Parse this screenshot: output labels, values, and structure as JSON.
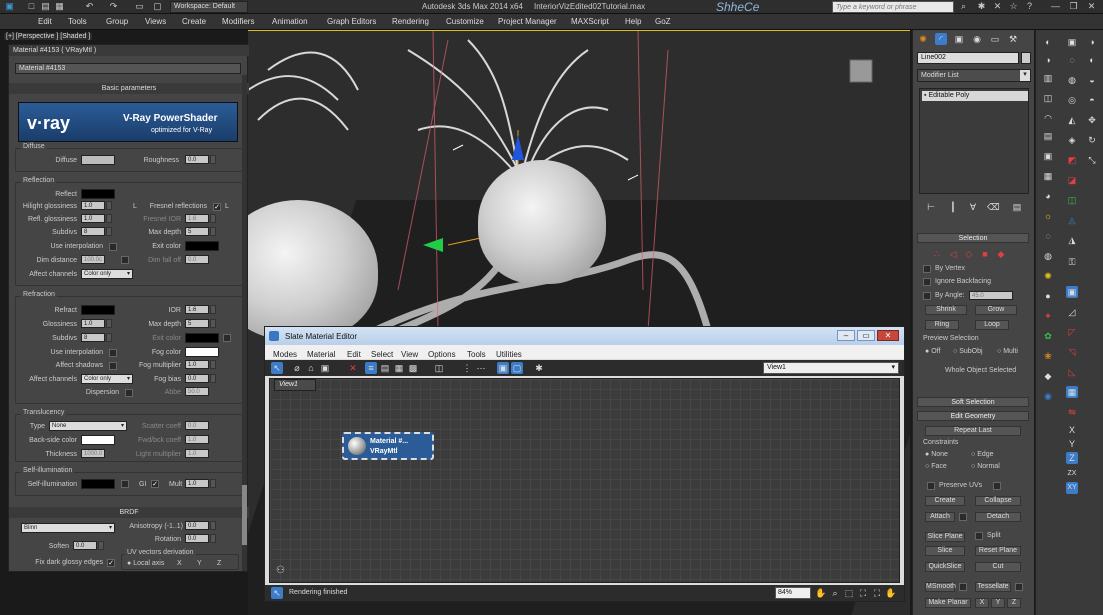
{
  "title_bar": {
    "workspace": "Workspace: Default",
    "app_title": "Autodesk 3ds Max  2014 x64",
    "file_name": "InteriorVizEdited02Tutorial.max",
    "logo_text": "ShheCe",
    "search_placeholder": "Type a keyword or phrase"
  },
  "menu": [
    "Edit",
    "Tools",
    "Group",
    "Views",
    "Create",
    "Modifiers",
    "Animation",
    "Graph Editors",
    "Rendering",
    "Customize",
    "Project Manager",
    "MAXScript",
    "Help",
    "GoZ"
  ],
  "viewport": {
    "label": "[+] [Perspective ] [Shaded ]"
  },
  "material_panel": {
    "title": "Material #4153  ( VRayMtl )",
    "name_field": "Material #4153",
    "basic_params": "Basic parameters",
    "banner": {
      "logo": "v·ray",
      "title": "V-Ray PowerShader",
      "subtitle": "optimized for V-Ray"
    },
    "diffuse": {
      "group": "Diffuse",
      "diffuse": "Diffuse",
      "roughness": "Roughness",
      "roughness_val": "0.0"
    },
    "reflection": {
      "group": "Reflection",
      "reflect": "Reflect",
      "hilight": "Hilight glossiness",
      "hilight_val": "1.0",
      "L": "L",
      "fresnel": "Fresnel reflections",
      "L2": "L",
      "refl_gloss": "Refl. glossiness",
      "refl_gloss_val": "1.0",
      "fresnel_ior": "Fresnel IOR",
      "fresnel_ior_val": "1.6",
      "subdivs": "Subdivs",
      "subdivs_val": "8",
      "max_depth": "Max depth",
      "max_depth_val": "5",
      "use_interp": "Use interpolation",
      "exit_color": "Exit color",
      "dim_distance": "Dim distance",
      "dim_distance_val": "100.0c",
      "dim_fall_off": "Dim fall off",
      "dim_fall_off_val": "0.0",
      "affect_channels": "Affect channels",
      "affect_val": "Color only"
    },
    "refraction": {
      "group": "Refraction",
      "refract": "Refract",
      "ior": "IOR",
      "ior_val": "1.6",
      "glossiness": "Glossiness",
      "glossiness_val": "1.0",
      "max_depth": "Max depth",
      "max_depth_val": "5",
      "subdivs": "Subdivs",
      "subdivs_val": "8",
      "exit_color": "Exit color",
      "use_interp": "Use interpolation",
      "fog_color": "Fog color",
      "affect_shadows": "Affect shadows",
      "fog_mult": "Fog multiplier",
      "fog_mult_val": "1.0",
      "affect_channels": "Affect channels",
      "affect_val": "Color only",
      "fog_bias": "Fog bias",
      "fog_bias_val": "0.0",
      "dispersion": "Dispersion",
      "abbe": "Abbe",
      "abbe_val": "50.0"
    },
    "translucency": {
      "group": "Translucency",
      "type": "Type",
      "type_val": "None",
      "scatter": "Scatter coeff",
      "scatter_val": "0.0",
      "backside": "Back-side color",
      "fwd_bck": "Fwd/bck coeff",
      "fwd_bck_val": "1.0",
      "thickness": "Thickness",
      "thickness_val": "1000.0",
      "light_mult": "Light multiplier",
      "light_mult_val": "1.0"
    },
    "self_illum": {
      "group": "Self-illumination",
      "label": "Self-illumination",
      "gi": "GI",
      "mult": "Mult",
      "mult_val": "1.0"
    },
    "brdf": {
      "group": "BRDF",
      "type_val": "Blinn",
      "anisotropy": "Anisotropy (-1..1)",
      "anisotropy_val": "0.0",
      "rotation": "Rotation",
      "rotation_val": "0.0",
      "soften": "Soften",
      "soften_val": "0.0",
      "uv_vectors": "UV vectors derivation",
      "fix_dark": "Fix dark glossy edges",
      "local_axis": "Local axis",
      "x": "X",
      "y": "Y",
      "z": "Z"
    }
  },
  "slate": {
    "title": "Slate Material Editor",
    "menu": [
      "Modes",
      "Material",
      "Edit",
      "Select",
      "View",
      "Options",
      "Tools",
      "Utilities"
    ],
    "view_dropdown": "View1",
    "tab": "View1",
    "node_title": "Material #...",
    "node_sub": "VRayMtl",
    "status": "Rendering finished",
    "zoom": "84%"
  },
  "command_panel": {
    "object_name": "Line002",
    "modifier_list": "Modifier List",
    "stack_item": "Editable Poly",
    "selection": {
      "head": "Selection",
      "by_vertex": "By Vertex",
      "ignore_backfacing": "Ignore Backfacing",
      "by_angle": "By Angle:",
      "by_angle_val": "45.0",
      "shrink": "Shrink",
      "grow": "Grow",
      "ring": "Ring",
      "loop": "Loop",
      "preview_selection": "Preview Selection",
      "off": "Off",
      "subobj": "SubObj",
      "multi": "Multi",
      "whole": "Whole Object Selected"
    },
    "soft_selection": "Soft Selection",
    "edit_geometry": "Edit Geometry",
    "repeat_last": "Repeat Last",
    "constraints": "Constraints",
    "none": "None",
    "edge": "Edge",
    "face": "Face",
    "normal": "Normal",
    "preserve_uvs": "Preserve UVs",
    "create": "Create",
    "collapse": "Collapse",
    "attach": "Attach",
    "detach": "Detach",
    "slice_plane": "Slice Plane",
    "split": "Split",
    "slice": "Slice",
    "reset_plane": "Reset Plane",
    "quickslice": "QuickSlice",
    "cut": "Cut",
    "msmooth": "MSmooth",
    "tessellate": "Tessellate",
    "make_planar": "Make Planar",
    "x": "X",
    "y": "Y",
    "z": "Z"
  },
  "far_right": {
    "labels": [
      "X",
      "Y",
      "Z",
      "ZX",
      "XY"
    ]
  }
}
